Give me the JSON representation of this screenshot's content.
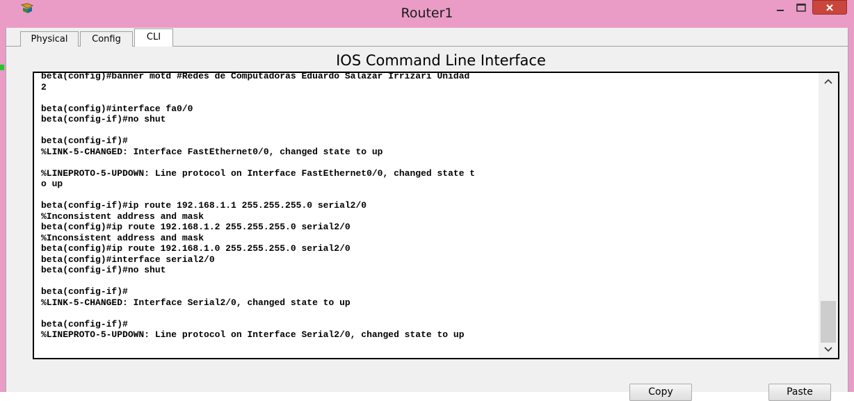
{
  "window": {
    "title": "Router1",
    "accent_color": "#ea9cc6",
    "close_color": "#c9463d"
  },
  "tabs": [
    {
      "label": "Physical",
      "active": false
    },
    {
      "label": "Config",
      "active": false
    },
    {
      "label": "CLI",
      "active": true
    }
  ],
  "cli": {
    "heading": "IOS Command Line Interface",
    "lines": [
      "beta(config)#banner motd #Redes de Computadoras Eduardo Salazar Irrizari Unidad",
      "2",
      "",
      "beta(config)#interface fa0/0",
      "beta(config-if)#no shut",
      "",
      "beta(config-if)#",
      "%LINK-5-CHANGED: Interface FastEthernet0/0, changed state to up",
      "",
      "%LINEPROTO-5-UPDOWN: Line protocol on Interface FastEthernet0/0, changed state t",
      "o up",
      "",
      "beta(config-if)#ip route 192.168.1.1 255.255.255.0 serial2/0",
      "%Inconsistent address and mask",
      "beta(config)#ip route 192.168.1.2 255.255.255.0 serial2/0",
      "%Inconsistent address and mask",
      "beta(config)#ip route 192.168.1.0 255.255.255.0 serial2/0",
      "beta(config)#interface serial2/0",
      "beta(config-if)#no shut",
      "",
      "beta(config-if)#",
      "%LINK-5-CHANGED: Interface Serial2/0, changed state to up",
      "",
      "beta(config-if)#",
      "%LINEPROTO-5-UPDOWN: Line protocol on Interface Serial2/0, changed state to up"
    ]
  },
  "buttons": {
    "copy_label": "Copy",
    "paste_label": "Paste"
  }
}
